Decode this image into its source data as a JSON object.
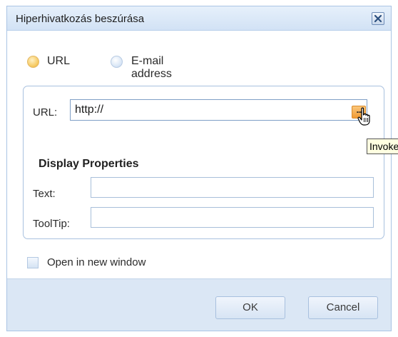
{
  "dialog": {
    "title": "Hiperhivatkozás beszúrása",
    "close_icon": "close-icon"
  },
  "link_type": {
    "options": [
      {
        "label": "URL",
        "checked": true
      },
      {
        "label": "E-mail address",
        "checked": false
      }
    ]
  },
  "url": {
    "label": "URL:",
    "value": "http://",
    "browse_label": "...",
    "tooltip": "Invoke"
  },
  "display_properties": {
    "title": "Display Properties",
    "text_label": "Text:",
    "text_value": "",
    "tooltip_label": "ToolTip:",
    "tooltip_value": ""
  },
  "open_new_window": {
    "label": "Open in new window",
    "checked": false
  },
  "buttons": {
    "ok": "OK",
    "cancel": "Cancel"
  },
  "colors": {
    "accent_orange": "#f09a33",
    "titlebar": "#d2e2f5",
    "footer": "#dbe7f5"
  }
}
